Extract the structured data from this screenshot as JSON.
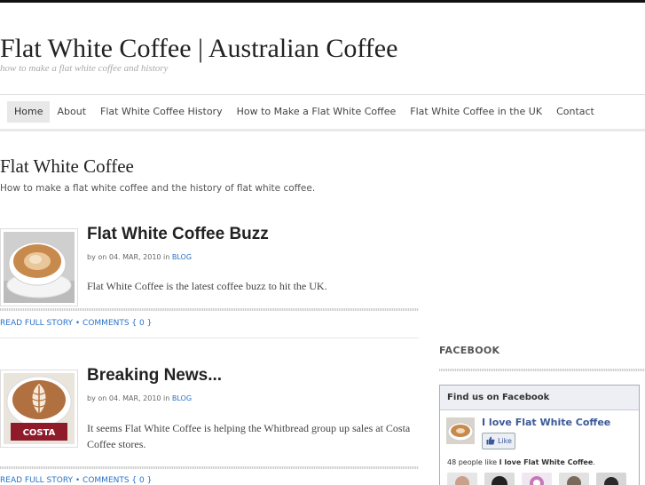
{
  "site": {
    "title": "Flat White Coffee | Australian Coffee",
    "tagline": "how to make a flat white coffee and history"
  },
  "nav": {
    "items": [
      {
        "label": "Home",
        "active": true
      },
      {
        "label": "About",
        "active": false
      },
      {
        "label": "Flat White Coffee History",
        "active": false
      },
      {
        "label": "How to Make a Flat White Coffee",
        "active": false
      },
      {
        "label": "Flat White Coffee in the UK",
        "active": false
      },
      {
        "label": "Contact",
        "active": false
      }
    ]
  },
  "page": {
    "title": "Flat White Coffee",
    "description": "How to make a flat white coffee and the history of flat white coffee."
  },
  "posts": [
    {
      "title": "Flat White Coffee Buzz",
      "meta_prefix": "by on 04. MAR, 2010 in ",
      "category": "BLOG",
      "excerpt": "Flat White Coffee is the latest coffee buzz to hit the UK.",
      "read_more": "READ FULL STORY",
      "separator": " • ",
      "comments": "COMMENTS { 0 }",
      "thumb_icon": "coffee-cup-image"
    },
    {
      "title": "Breaking News...",
      "meta_prefix": "by on 04. MAR, 2010 in ",
      "category": "BLOG",
      "excerpt": "It seems Flat White Coffee is helping the Whitbread group up sales at Costa Coffee stores.",
      "read_more": "READ FULL STORY",
      "separator": " • ",
      "comments": "COMMENTS { 0 }",
      "thumb_icon": "costa-latte-art-image",
      "thumb_text": "COSTA"
    }
  ],
  "sidebar": {
    "heading": "FACEBOOK",
    "facebook": {
      "header": "Find us on Facebook",
      "page_name": "I love Flat White Coffee",
      "like_label": "Like",
      "count_prefix": "48 people like ",
      "count_page": "I love Flat White Coffee",
      "count_suffix": ".",
      "brand_color": "#3b5998"
    }
  },
  "colors": {
    "link": "#2a72c9",
    "nav_active_bg": "#e8e8e8"
  }
}
